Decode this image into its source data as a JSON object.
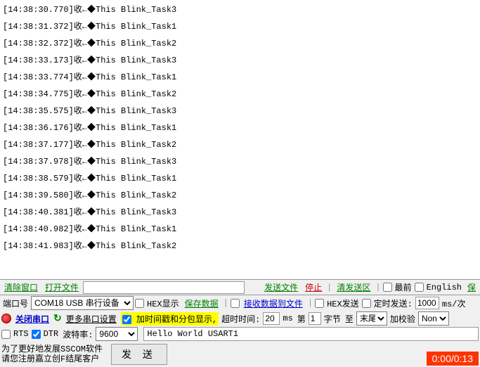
{
  "log": [
    "[14:38:30.770]收←◆This Blink_Task3",
    "[14:38:31.372]收←◆This Blink_Task1",
    "[14:38:32.372]收←◆This Blink_Task2",
    "[14:38:33.173]收←◆This Blink_Task3",
    "[14:38:33.774]收←◆This Blink_Task1",
    "[14:38:34.775]收←◆This Blink_Task2",
    "[14:38:35.575]收←◆This Blink_Task3",
    "[14:38:36.176]收←◆This Blink_Task1",
    "[14:38:37.177]收←◆This Blink_Task2",
    "[14:38:37.978]收←◆This Blink_Task3",
    "[14:38:38.579]收←◆This Blink_Task1",
    "[14:38:39.580]收←◆This Blink_Task2",
    "[14:38:40.381]收←◆This Blink_Task3",
    "[14:38:40.982]收←◆This Blink_Task1",
    "[14:38:41.983]收←◆This Blink_Task2"
  ],
  "tb1": {
    "clear_window": "清除窗口",
    "open_file": "打开文件",
    "file_path": "",
    "send_file": "发送文件",
    "stop": "停止",
    "clear_send": "清发送区",
    "top_most": "最前",
    "english": "English",
    "save": "保"
  },
  "tb2": {
    "port_label": "端口号",
    "port_value": "COM18 USB 串行设备",
    "hex_display": "HEX显示",
    "save_data": "保存数据",
    "recv_to_file": "接收数据到文件",
    "hex_send": "HEX发送",
    "timed_send": "定时发送:",
    "timed_value": "1000",
    "timed_unit": "ms/次"
  },
  "tb3": {
    "close_port": "关闭串口",
    "more_settings": "更多串口设置",
    "timestamp_pkt": "加时间戳和分包显示,",
    "timeout_label": "超时时间:",
    "timeout_value": "20",
    "timeout_unit": "ms",
    "nth_label": "第",
    "nth_value": "1",
    "byte_label": "字节",
    "to_label": "至",
    "end_value": "末尾",
    "add_check": "加校验",
    "check_value": "None",
    "rts": "RTS",
    "dtr": "DTR",
    "baud_label": "波特率:",
    "baud_value": "9600"
  },
  "tx": {
    "value": "Hello World USART1"
  },
  "footer": {
    "line1": "为了更好地发展SSCOM软件",
    "line2": "请您注册嘉立创F结尾客户",
    "send_btn": "发 送",
    "timer": "0:00/0:13"
  }
}
